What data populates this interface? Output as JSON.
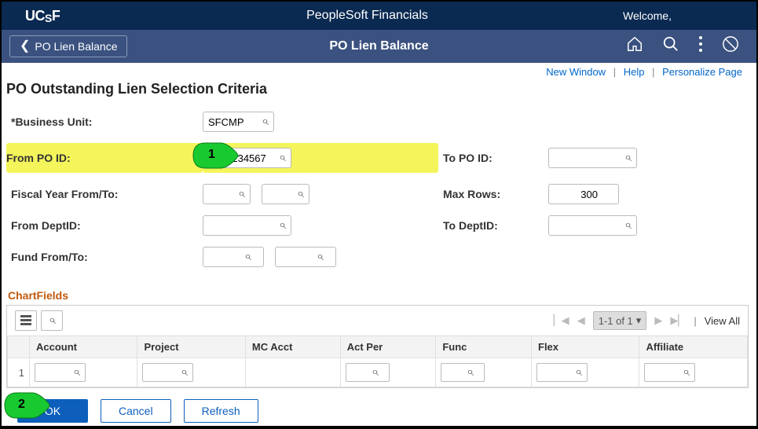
{
  "header": {
    "logo_text": "UCSF",
    "app_title": "PeopleSoft Financials",
    "welcome": "Welcome,"
  },
  "nav": {
    "back_label": "PO Lien Balance",
    "page_title": "PO Lien Balance"
  },
  "links": {
    "new_window": "New Window",
    "help": "Help",
    "personalize": "Personalize Page"
  },
  "page_heading": "PO Outstanding Lien Selection Criteria",
  "annotations": {
    "one": "1",
    "two": "2"
  },
  "form": {
    "business_unit_label": "*Business Unit:",
    "business_unit_value": "SFCMP",
    "from_po_label": "From PO ID:",
    "from_po_value": "B001234567",
    "to_po_label": "To PO ID:",
    "to_po_value": "",
    "fiscal_label": "Fiscal Year From/To:",
    "fiscal_from": "",
    "fiscal_to": "",
    "max_rows_label": "Max Rows:",
    "max_rows_value": "300",
    "from_dept_label": "From DeptID:",
    "from_dept_value": "",
    "to_dept_label": "To DeptID:",
    "to_dept_value": "",
    "fund_label": "Fund From/To:",
    "fund_from": "",
    "fund_to": ""
  },
  "chartfields": {
    "title": "ChartFields",
    "pager_text": "1-1 of 1",
    "view_all": "View All",
    "headers": {
      "account": "Account",
      "project": "Project",
      "mc_acct": "MC Acct",
      "act_per": "Act Per",
      "func": "Func",
      "flex": "Flex",
      "affiliate": "Affiliate"
    },
    "row1": {
      "num": "1",
      "account": "",
      "project": "",
      "mc_acct": "",
      "act_per": "",
      "func": "",
      "flex": "",
      "affiliate": ""
    }
  },
  "buttons": {
    "ok": "OK",
    "cancel": "Cancel",
    "refresh": "Refresh"
  }
}
